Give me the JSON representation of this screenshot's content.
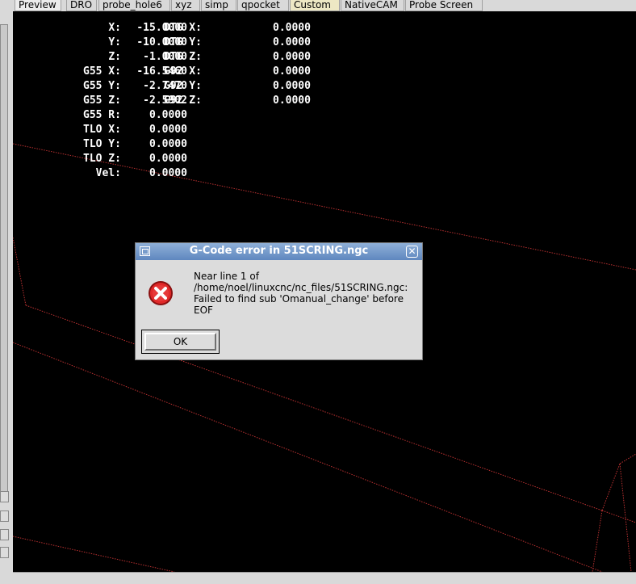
{
  "tabs": [
    {
      "label": "Preview",
      "active": true
    },
    {
      "label": "DRO"
    },
    {
      "label": "probe_hole6"
    },
    {
      "label": "xyz"
    },
    {
      "label": "simp"
    },
    {
      "label": "qpocket"
    },
    {
      "label": "Custom"
    },
    {
      "label": "NativeCAM"
    },
    {
      "label": "Probe Screen"
    }
  ],
  "dro": {
    "rows": [
      {
        "label": "X:",
        "value": "-15.0000",
        "dtg_label": "DTG X:",
        "dtg_value": "0.0000"
      },
      {
        "label": "Y:",
        "value": "-10.0000",
        "dtg_label": "DTG Y:",
        "dtg_value": "0.0000"
      },
      {
        "label": "Z:",
        "value": "-1.0000",
        "dtg_label": "DTG Z:",
        "dtg_value": "0.0000"
      },
      {
        "label": "G55 X:",
        "value": "-16.5460",
        "dtg_label": "G92 X:",
        "dtg_value": "0.0000"
      },
      {
        "label": "G55 Y:",
        "value": "-2.7470",
        "dtg_label": "G92 Y:",
        "dtg_value": "0.0000"
      },
      {
        "label": "G55 Z:",
        "value": "-2.5902",
        "dtg_label": "G92 Z:",
        "dtg_value": "0.0000"
      },
      {
        "label": "G55 R:",
        "value": "0.0000"
      },
      {
        "label": "TLO X:",
        "value": "0.0000"
      },
      {
        "label": "TLO Y:",
        "value": "0.0000"
      },
      {
        "label": "TLO Z:",
        "value": "0.0000"
      },
      {
        "label": "Vel:",
        "value": "0.0000"
      }
    ]
  },
  "dialog": {
    "title": "G-Code error in 51SCRING.ngc",
    "message_lines": [
      "Near line 1 of",
      "/home/noel/linuxcnc/nc_files/51SCRING.ngc:",
      "Failed to find sub 'Omanual_change' before",
      "EOF"
    ],
    "ok_label": "OK",
    "icon": "error-icon",
    "close_icon": "close-icon"
  },
  "colors": {
    "canvas_bg": "#000000",
    "toolpath": "#c03030",
    "title_bar": "#6f93c6",
    "error_red": "#e02020"
  }
}
